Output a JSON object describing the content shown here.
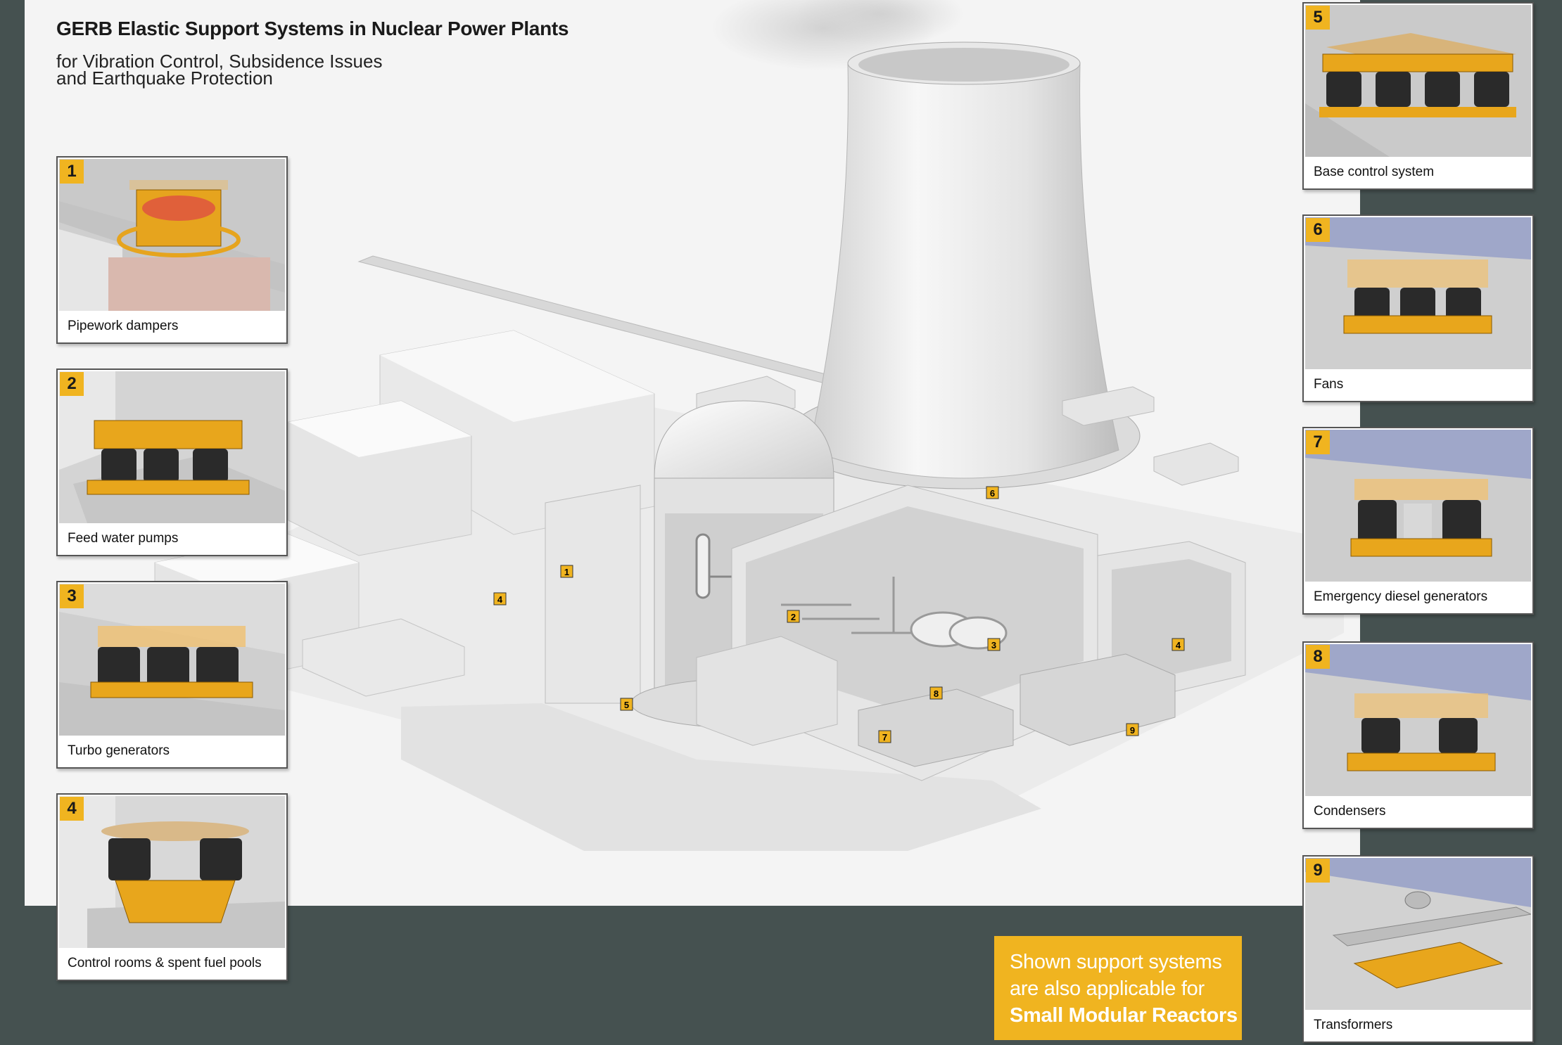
{
  "title": "GERB Elastic Support Systems in Nuclear Power Plants",
  "subtitle": "for Vibration Control, Subsidence Issues\nand Earthquake Protection",
  "colors": {
    "accent": "#f0b420",
    "frame": "#455150",
    "canvas": "#f4f4f4"
  },
  "cards": [
    {
      "num": "1",
      "label": "Pipework dampers"
    },
    {
      "num": "2",
      "label": "Feed water pumps"
    },
    {
      "num": "3",
      "label": "Turbo generators"
    },
    {
      "num": "4",
      "label": "Control rooms & spent fuel pools"
    },
    {
      "num": "5",
      "label": "Base control system"
    },
    {
      "num": "6",
      "label": "Fans"
    },
    {
      "num": "7",
      "label": "Emergency diesel generators"
    },
    {
      "num": "8",
      "label": "Condensers"
    },
    {
      "num": "9",
      "label": "Transformers"
    }
  ],
  "markers": [
    "1",
    "2",
    "3",
    "4",
    "4",
    "5",
    "6",
    "7",
    "8",
    "9"
  ],
  "note": {
    "line1": "Shown support systems",
    "line2": "are also applicable for",
    "line3": "Small Modular Reactors"
  }
}
